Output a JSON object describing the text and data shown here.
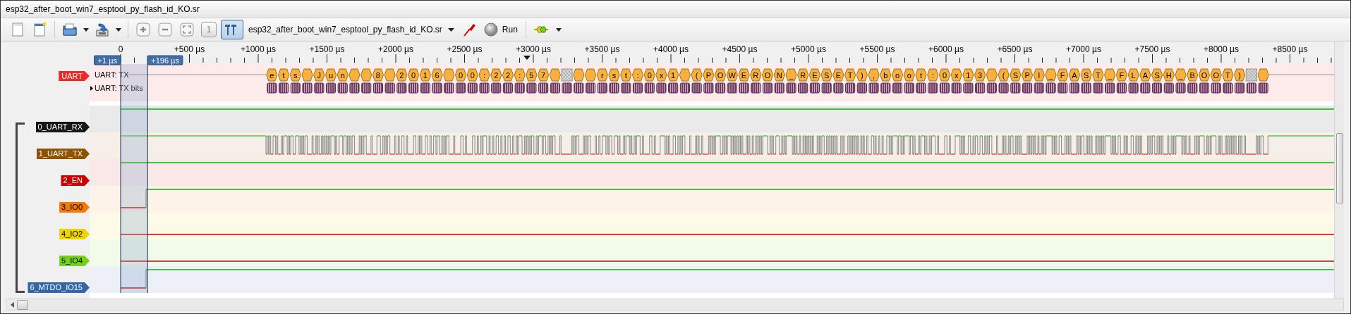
{
  "window": {
    "title": "esp32_after_boot_win7_esptool_py_flash_id_KO.sr"
  },
  "toolbar": {
    "zoom_one_label": "1",
    "cursors_shown": true,
    "device": "esp32_after_boot_win7_esptool_py_flash_id_KO.sr",
    "run_label": "Run"
  },
  "ruler": {
    "ticks": [
      "0",
      "+500 µs",
      "+1000 µs",
      "+1500 µs",
      "+2000 µs",
      "+2500 µs",
      "+3000 µs",
      "+3500 µs",
      "+4000 µs",
      "+4500 µs",
      "+5000 µs",
      "+5500 µs",
      "+6000 µs",
      "+6500 µs",
      "+7000 µs",
      "+7500 µs",
      "+8000 µs",
      "+8500 µs"
    ],
    "cursors": [
      {
        "label": "+1 µs"
      },
      {
        "label": "+196 µs"
      }
    ]
  },
  "decoder": {
    "name": "UART",
    "rows": [
      {
        "label": "UART: TX"
      },
      {
        "label": "UART: TX bits"
      }
    ],
    "annotations": [
      {
        "kind": "char",
        "text": "e"
      },
      {
        "kind": "char",
        "text": "t"
      },
      {
        "kind": "char",
        "text": "s"
      },
      {
        "kind": "blank"
      },
      {
        "kind": "char",
        "text": "J"
      },
      {
        "kind": "char",
        "text": "u"
      },
      {
        "kind": "char",
        "text": "n"
      },
      {
        "kind": "blank"
      },
      {
        "kind": "blank"
      },
      {
        "kind": "char",
        "text": "8"
      },
      {
        "kind": "blank"
      },
      {
        "kind": "char",
        "text": "2"
      },
      {
        "kind": "char",
        "text": "0"
      },
      {
        "kind": "char",
        "text": "1"
      },
      {
        "kind": "char",
        "text": "6"
      },
      {
        "kind": "blank"
      },
      {
        "kind": "char",
        "text": "0"
      },
      {
        "kind": "char",
        "text": "0"
      },
      {
        "kind": "char",
        "text": ":"
      },
      {
        "kind": "char",
        "text": "2"
      },
      {
        "kind": "char",
        "text": "2"
      },
      {
        "kind": "char",
        "text": ":"
      },
      {
        "kind": "char",
        "text": "5"
      },
      {
        "kind": "char",
        "text": "7"
      },
      {
        "kind": "blank"
      },
      {
        "kind": "error"
      },
      {
        "kind": "blank"
      },
      {
        "kind": "blank"
      },
      {
        "kind": "char",
        "text": "r"
      },
      {
        "kind": "char",
        "text": "s"
      },
      {
        "kind": "char",
        "text": "t"
      },
      {
        "kind": "char",
        "text": ":"
      },
      {
        "kind": "char",
        "text": "0"
      },
      {
        "kind": "char",
        "text": "x"
      },
      {
        "kind": "char",
        "text": "1"
      },
      {
        "kind": "blank"
      },
      {
        "kind": "char",
        "text": "("
      },
      {
        "kind": "char",
        "text": "P"
      },
      {
        "kind": "char",
        "text": "O"
      },
      {
        "kind": "char",
        "text": "W"
      },
      {
        "kind": "char",
        "text": "E"
      },
      {
        "kind": "char",
        "text": "R"
      },
      {
        "kind": "char",
        "text": "O"
      },
      {
        "kind": "char",
        "text": "N"
      },
      {
        "kind": "char",
        "text": "_"
      },
      {
        "kind": "char",
        "text": "R"
      },
      {
        "kind": "char",
        "text": "E"
      },
      {
        "kind": "char",
        "text": "S"
      },
      {
        "kind": "char",
        "text": "E"
      },
      {
        "kind": "char",
        "text": "T"
      },
      {
        "kind": "char",
        "text": ")"
      },
      {
        "kind": "char",
        "text": ","
      },
      {
        "kind": "char",
        "text": "b"
      },
      {
        "kind": "char",
        "text": "o"
      },
      {
        "kind": "char",
        "text": "o"
      },
      {
        "kind": "char",
        "text": "t"
      },
      {
        "kind": "char",
        "text": ":"
      },
      {
        "kind": "char",
        "text": "0"
      },
      {
        "kind": "char",
        "text": "x"
      },
      {
        "kind": "char",
        "text": "1"
      },
      {
        "kind": "char",
        "text": "3"
      },
      {
        "kind": "blank"
      },
      {
        "kind": "char",
        "text": "("
      },
      {
        "kind": "char",
        "text": "S"
      },
      {
        "kind": "char",
        "text": "P"
      },
      {
        "kind": "char",
        "text": "I"
      },
      {
        "kind": "char",
        "text": "_"
      },
      {
        "kind": "char",
        "text": "F"
      },
      {
        "kind": "char",
        "text": "A"
      },
      {
        "kind": "char",
        "text": "S"
      },
      {
        "kind": "char",
        "text": "T"
      },
      {
        "kind": "char",
        "text": "_"
      },
      {
        "kind": "char",
        "text": "F"
      },
      {
        "kind": "char",
        "text": "L"
      },
      {
        "kind": "char",
        "text": "A"
      },
      {
        "kind": "char",
        "text": "S"
      },
      {
        "kind": "char",
        "text": "H"
      },
      {
        "kind": "char",
        "text": "_"
      },
      {
        "kind": "char",
        "text": "B"
      },
      {
        "kind": "char",
        "text": "O"
      },
      {
        "kind": "char",
        "text": "O"
      },
      {
        "kind": "char",
        "text": "T"
      },
      {
        "kind": "char",
        "text": ")"
      },
      {
        "kind": "error"
      },
      {
        "kind": "blank"
      }
    ]
  },
  "channels": [
    {
      "name": "0_UART_RX",
      "color": "#16191a",
      "kind": "high"
    },
    {
      "name": "1_UART_TX",
      "color": "#8f5202",
      "kind": "serial"
    },
    {
      "name": "2_EN",
      "color": "#cc0000",
      "kind": "high"
    },
    {
      "name": "3_IO0",
      "color": "#f57900",
      "kind": "rising"
    },
    {
      "name": "4_IO2",
      "color": "#edd400",
      "kind": "low"
    },
    {
      "name": "5_IO4",
      "color": "#73d216",
      "kind": "low"
    },
    {
      "name": "6_MTDO_IO15",
      "color": "#3465a4",
      "kind": "rising"
    }
  ]
}
